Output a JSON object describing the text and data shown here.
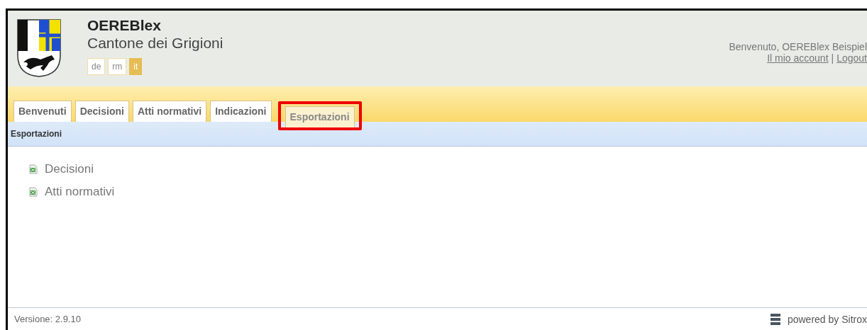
{
  "header": {
    "app_name": "OEREBlex",
    "canton": "Cantone dei Grigioni",
    "languages": [
      {
        "label": "de",
        "selected": false
      },
      {
        "label": "rm",
        "selected": false
      },
      {
        "label": "it",
        "selected": true
      }
    ],
    "welcome": "Benvenuto, OEREBlex Beispiel",
    "account_link": "Il mio account",
    "separator": "|",
    "logout_link": "Logout"
  },
  "tabs": [
    {
      "label": "Benvenuti",
      "selected": false,
      "highlighted": false
    },
    {
      "label": "Decisioni",
      "selected": false,
      "highlighted": false
    },
    {
      "label": "Atti normativi",
      "selected": false,
      "highlighted": false
    },
    {
      "label": "Indicazioni",
      "selected": false,
      "highlighted": false
    },
    {
      "label": "Esportazioni",
      "selected": true,
      "highlighted": true
    }
  ],
  "breadcrumb": "Esportazioni",
  "exports": [
    {
      "label": "Decisioni"
    },
    {
      "label": "Atti normativi"
    }
  ],
  "footer": {
    "version": "Versione: 2.9.10",
    "powered_by": "powered by Sitrox"
  }
}
